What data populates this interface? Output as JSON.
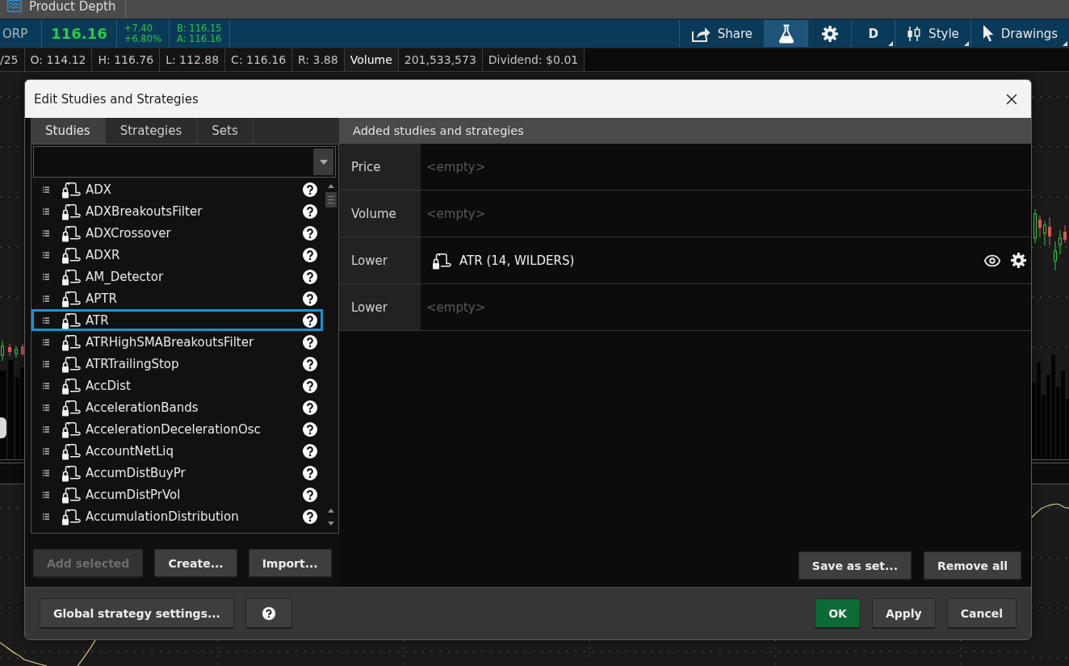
{
  "chart_tab": {
    "label": "Product Depth"
  },
  "quote": {
    "symbol": "ORP",
    "last": "116.16",
    "change": "+7.40",
    "change_percent": "+6.80%",
    "bid": "B: 116.15",
    "ask": "A: 116.16"
  },
  "toolbar": [
    {
      "kind": "share",
      "label": "Share",
      "selected": false,
      "has_menu": false
    },
    {
      "kind": "studies",
      "selected": true,
      "has_menu": false
    },
    {
      "kind": "settings",
      "selected": false,
      "has_menu": false
    },
    {
      "kind": "aggregation",
      "label": "D",
      "selected": false,
      "has_menu": true
    },
    {
      "kind": "style",
      "label": "Style",
      "selected": false,
      "has_menu": true
    },
    {
      "kind": "drawings",
      "label": "Drawings",
      "selected": false,
      "has_menu": true
    }
  ],
  "price_info": [
    {
      "text": "/25",
      "emphasis": false
    },
    {
      "text": "O: 114.12",
      "emphasis": false
    },
    {
      "text": "H: 116.76",
      "emphasis": false
    },
    {
      "text": "L: 112.88",
      "emphasis": false
    },
    {
      "text": "C: 116.16",
      "emphasis": false
    },
    {
      "text": "R: 3.88",
      "emphasis": false
    },
    {
      "text": "Volume",
      "emphasis": true
    },
    {
      "text": "201,533,573",
      "emphasis": false
    },
    {
      "text": "Dividend: $0.01",
      "emphasis": false
    }
  ],
  "dialog": {
    "title": "Edit Studies and Strategies",
    "tabs": [
      {
        "label": "Studies",
        "selected": true
      },
      {
        "label": "Strategies",
        "selected": false
      },
      {
        "label": "Sets",
        "selected": false
      }
    ],
    "studies": [
      {
        "name": "ADX",
        "selected": false
      },
      {
        "name": "ADXBreakoutsFilter",
        "selected": false
      },
      {
        "name": "ADXCrossover",
        "selected": false
      },
      {
        "name": "ADXR",
        "selected": false
      },
      {
        "name": "AM_Detector",
        "selected": false
      },
      {
        "name": "APTR",
        "selected": false
      },
      {
        "name": "ATR",
        "selected": true
      },
      {
        "name": "ATRHighSMABreakoutsFilter",
        "selected": false
      },
      {
        "name": "ATRTrailingStop",
        "selected": false
      },
      {
        "name": "AccDist",
        "selected": false
      },
      {
        "name": "AccelerationBands",
        "selected": false
      },
      {
        "name": "AccelerationDecelerationOsc",
        "selected": false
      },
      {
        "name": "AccountNetLiq",
        "selected": false
      },
      {
        "name": "AccumDistBuyPr",
        "selected": false
      },
      {
        "name": "AccumDistPrVol",
        "selected": false
      },
      {
        "name": "AccumulationDistribution",
        "selected": false
      }
    ],
    "list_buttons": [
      {
        "label": "Add selected",
        "disabled": true
      },
      {
        "label": "Create...",
        "disabled": false
      },
      {
        "label": "Import...",
        "disabled": false
      }
    ],
    "added": {
      "title": "Added studies and strategies",
      "rows": [
        {
          "section": "Price",
          "kind": "empty",
          "text": "<empty>"
        },
        {
          "section": "Volume",
          "kind": "empty",
          "text": "<empty>"
        },
        {
          "section": "Lower",
          "kind": "study",
          "text": "ATR (14, WILDERS)"
        },
        {
          "section": "Lower",
          "kind": "empty",
          "text": "<empty>"
        }
      ],
      "buttons": [
        {
          "label": "Save as set..."
        },
        {
          "label": "Remove all"
        }
      ]
    },
    "footer_left": [
      {
        "kind": "text",
        "label": "Global strategy settings..."
      },
      {
        "kind": "help"
      }
    ],
    "footer_right": [
      {
        "label": "OK",
        "primary": true
      },
      {
        "label": "Apply",
        "primary": false
      },
      {
        "label": "Cancel",
        "primary": false
      }
    ]
  }
}
